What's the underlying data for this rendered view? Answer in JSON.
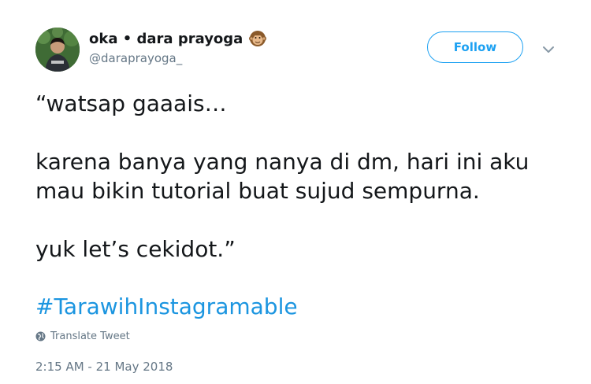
{
  "author": {
    "display_name": "oka • dara prayoga",
    "handle": "@daraprayoga_",
    "avatar_icon": "profile-photo",
    "name_emoji_icon": "monkey-face-icon"
  },
  "header": {
    "follow_label": "Follow",
    "caret_icon": "chevron-down-icon"
  },
  "tweet": {
    "paragraphs": [
      {
        "lines": [
          "“watsap gaaais…"
        ]
      },
      {
        "lines": [
          "karena banya yang nanya di dm, hari ini aku",
          "mau bikin tutorial buat sujud sempurna."
        ]
      },
      {
        "lines": [
          "yuk let’s cekidot.”"
        ]
      }
    ],
    "hashtag": "#TarawihInstagramable"
  },
  "footer": {
    "translate_label": "Translate Tweet",
    "translate_icon": "globe-icon",
    "timestamp": "2:15 AM - 21 May 2018"
  },
  "colors": {
    "accent": "#1da1f2",
    "hashtag": "#1b95e0",
    "text": "#14171a",
    "muted": "#657786"
  }
}
